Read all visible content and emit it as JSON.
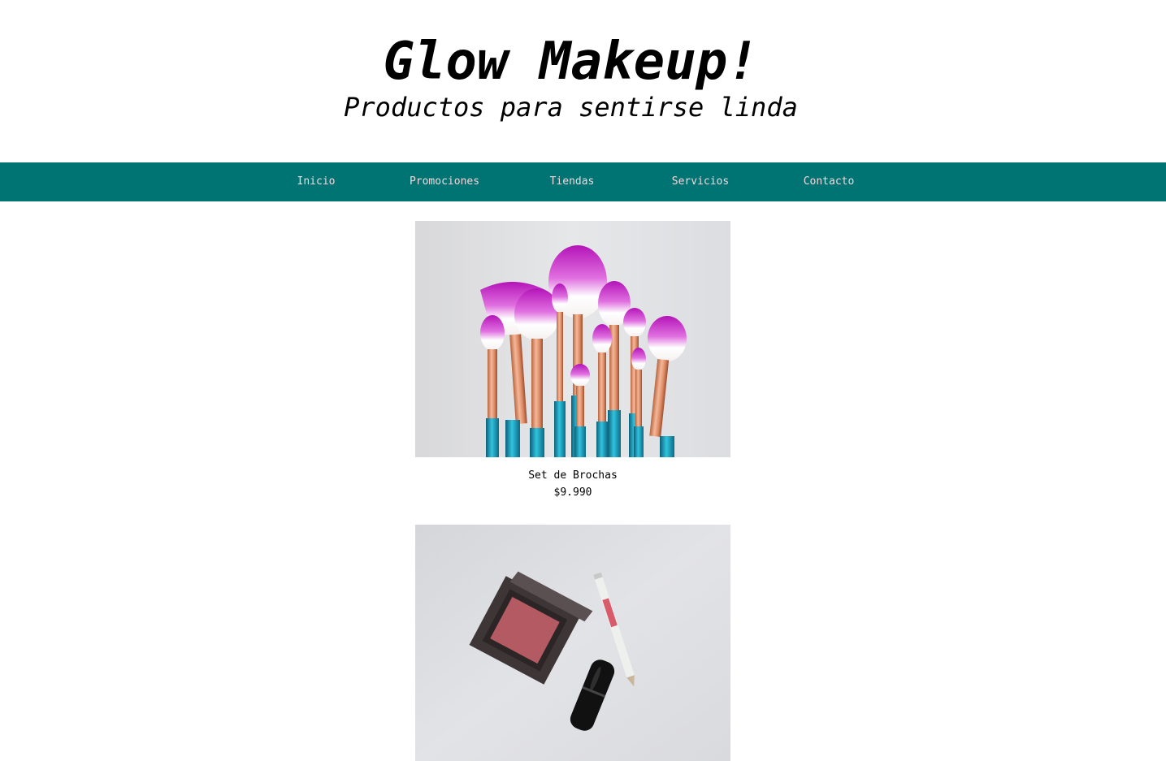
{
  "header": {
    "title": "Glow Makeup!",
    "subtitle": "Productos para sentirse linda"
  },
  "nav": {
    "items": [
      {
        "label": "Inicio"
      },
      {
        "label": "Promociones"
      },
      {
        "label": "Tiendas"
      },
      {
        "label": "Servicios"
      },
      {
        "label": "Contacto"
      }
    ]
  },
  "products": [
    {
      "name": "Set de Brochas",
      "price": "$9.990",
      "image": "makeup-brushes-photo"
    },
    {
      "name": "",
      "price": "",
      "image": "blush-lipstick-pencil-photo"
    }
  ],
  "colors": {
    "nav_bg": "#007472",
    "nav_text": "#f5d6dc",
    "brush_tip": "#c21bc4",
    "brush_ferrule": "#e0906a",
    "brush_handle": "#1a8fa6",
    "blush": "#b45a62"
  }
}
